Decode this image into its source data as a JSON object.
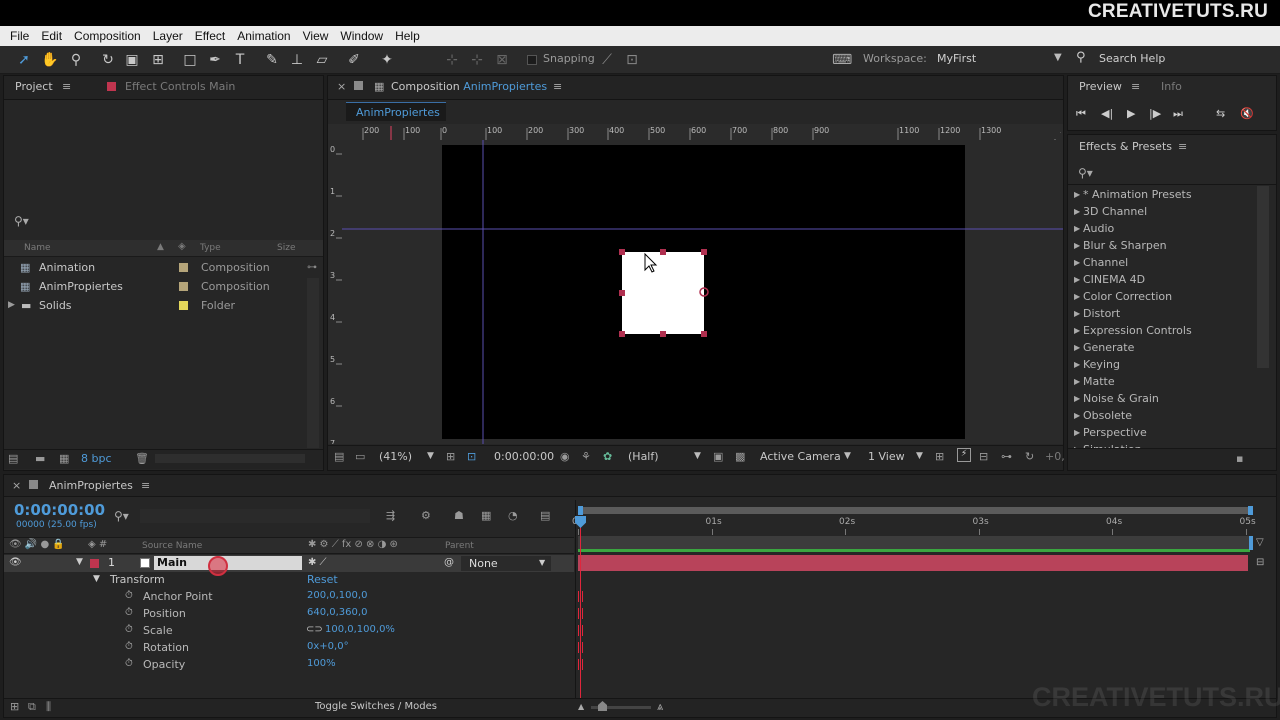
{
  "brand": "CREATIVETUTS.RU",
  "watermark": "CREATIVETUTS.RU",
  "menu": [
    "File",
    "Edit",
    "Composition",
    "Layer",
    "Effect",
    "Animation",
    "View",
    "Window",
    "Help"
  ],
  "toolbar": {
    "snapping_label": "Snapping",
    "workspace_label": "Workspace:",
    "workspace_value": "MyFirst",
    "search_help": "Search Help"
  },
  "project_panel": {
    "tab_project": "Project",
    "tab_effect_controls": "Effect Controls Main",
    "columns": {
      "name": "Name",
      "type": "Type",
      "size": "Size"
    },
    "items": [
      {
        "name": "Animation",
        "type": "Composition",
        "color": "#b5a57a"
      },
      {
        "name": "AnimPropiertes",
        "type": "Composition",
        "color": "#b5a57a"
      },
      {
        "name": "Solids",
        "type": "Folder",
        "color": "#e3d65a"
      }
    ],
    "bpc": "8 bpc"
  },
  "comp_panel": {
    "tab_prefix": "Composition",
    "tab_name": "AnimPropiertes",
    "subtab": "AnimPropiertes",
    "ruler_top": [
      "200",
      "100",
      "0",
      "100",
      "200",
      "300",
      "400",
      "500",
      "600",
      "700",
      "800",
      "900",
      "1100",
      "1200",
      "1300",
      "1"
    ],
    "ruler_left": [
      "0",
      "1",
      "2",
      "3",
      "4",
      "5",
      "6",
      "7"
    ],
    "zoom": "(41%)",
    "timecode": "0:00:00:00",
    "resolution": "(Half)",
    "camera": "Active Camera",
    "views": "1 View",
    "offset": "+0,"
  },
  "preview_panel": {
    "tab_preview": "Preview",
    "tab_info": "Info"
  },
  "effects_panel": {
    "title": "Effects & Presets",
    "items": [
      "* Animation Presets",
      "3D Channel",
      "Audio",
      "Blur & Sharpen",
      "Channel",
      "CINEMA 4D",
      "Color Correction",
      "Distort",
      "Expression Controls",
      "Generate",
      "Keying",
      "Matte",
      "Noise & Grain",
      "Obsolete",
      "Perspective",
      "Simulation"
    ]
  },
  "timeline": {
    "tab_name": "AnimPropiertes",
    "timecode": "0:00:00:00",
    "fps": "00000 (25.00 fps)",
    "col_source": "Source Name",
    "col_parent": "Parent",
    "layer": {
      "number": "1",
      "name": "Main",
      "parent": "None"
    },
    "transform_label": "Transform",
    "reset_label": "Reset",
    "properties": [
      {
        "name": "Anchor Point",
        "value": "200,0,100,0"
      },
      {
        "name": "Position",
        "value": "640,0,360,0"
      },
      {
        "name": "Scale",
        "value": "100,0,100,0%"
      },
      {
        "name": "Rotation",
        "value": "0x+0,0°"
      },
      {
        "name": "Opacity",
        "value": "100%"
      }
    ],
    "time_ticks": [
      "0s",
      "01s",
      "02s",
      "03s",
      "04s",
      "05s"
    ],
    "toggle_label": "Toggle Switches / Modes"
  },
  "colors": {
    "accent": "#4f9bd9",
    "layer_bar": "#b8435a",
    "label_red": "#c0354f"
  }
}
